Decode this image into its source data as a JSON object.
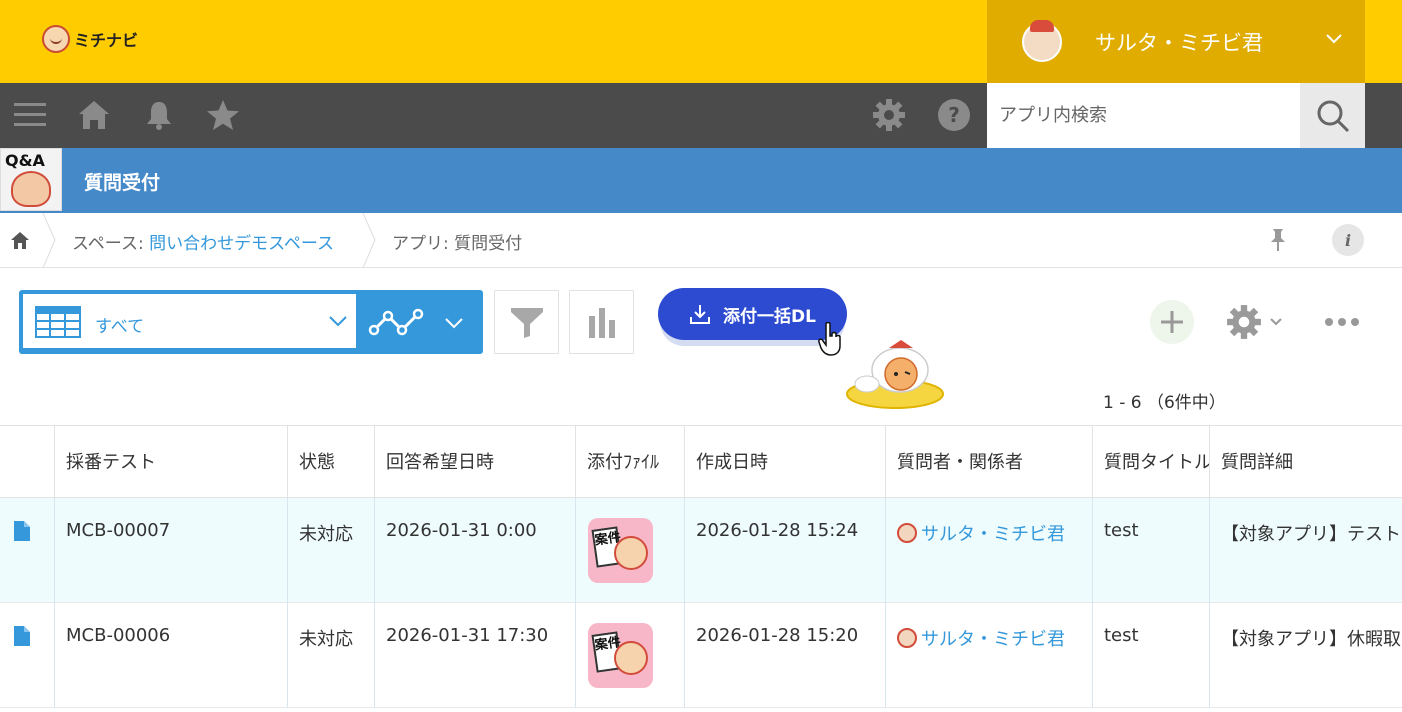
{
  "header": {
    "logo_text": "ミチナビ",
    "user_name": "サルタ・ミチビ君"
  },
  "nav": {
    "search_placeholder": "アプリ内検索"
  },
  "app": {
    "icon_text": "Q&A",
    "title": "質問受付"
  },
  "breadcrumb": {
    "space_prefix": "スペース: ",
    "space_name": "問い合わせデモスペース",
    "app_label": "アプリ: 質問受付"
  },
  "toolbar": {
    "view_name": "すべて",
    "download_label": "添付一括DL",
    "count_text": "1 - 6 （6件中）"
  },
  "table": {
    "columns": [
      "採番テスト",
      "状態",
      "回答希望日時",
      "添付ﾌｧｲﾙ",
      "作成日時",
      "質問者・関係者",
      "質問タイトル",
      "質問詳細"
    ],
    "rows": [
      {
        "number": "MCB-00007",
        "status": "未対応",
        "desired_date": "2026-01-31 0:00",
        "attachment_text": "案件",
        "created": "2026-01-28 15:24",
        "requester": "サルタ・ミチビ君",
        "title": "test",
        "detail": "【対象アプリ】テスト"
      },
      {
        "number": "MCB-00006",
        "status": "未対応",
        "desired_date": "2026-01-31 17:30",
        "attachment_text": "案件",
        "created": "2026-01-28 15:20",
        "requester": "サルタ・ミチビ君",
        "title": "test",
        "detail": "【対象アプリ】休暇取"
      }
    ]
  },
  "colors": {
    "header_yellow": "#ffcc00",
    "user_box": "#e0ac00",
    "nav_dark": "#4b4b4b",
    "app_blue": "#4589c9",
    "accent_blue": "#3498db",
    "download_button": "#2c4bd0",
    "row_alt": "#effcfe"
  }
}
